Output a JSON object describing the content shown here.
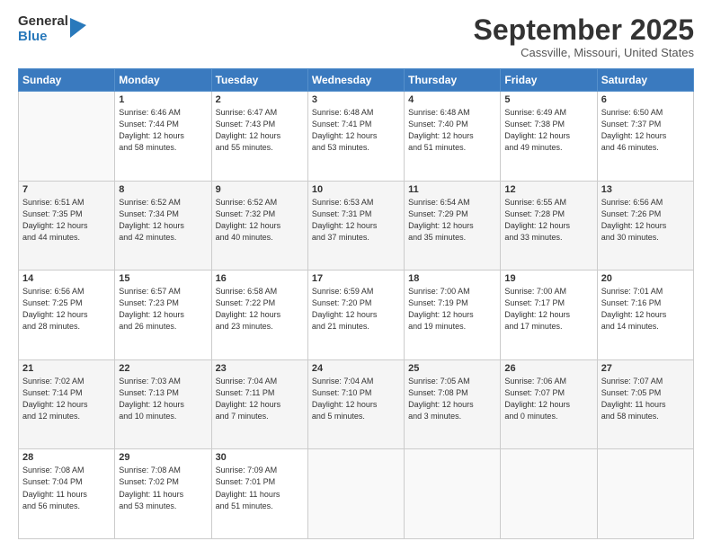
{
  "header": {
    "logo_general": "General",
    "logo_blue": "Blue",
    "month": "September 2025",
    "location": "Cassville, Missouri, United States"
  },
  "days_of_week": [
    "Sunday",
    "Monday",
    "Tuesday",
    "Wednesday",
    "Thursday",
    "Friday",
    "Saturday"
  ],
  "weeks": [
    [
      {
        "num": "",
        "info": ""
      },
      {
        "num": "1",
        "info": "Sunrise: 6:46 AM\nSunset: 7:44 PM\nDaylight: 12 hours\nand 58 minutes."
      },
      {
        "num": "2",
        "info": "Sunrise: 6:47 AM\nSunset: 7:43 PM\nDaylight: 12 hours\nand 55 minutes."
      },
      {
        "num": "3",
        "info": "Sunrise: 6:48 AM\nSunset: 7:41 PM\nDaylight: 12 hours\nand 53 minutes."
      },
      {
        "num": "4",
        "info": "Sunrise: 6:48 AM\nSunset: 7:40 PM\nDaylight: 12 hours\nand 51 minutes."
      },
      {
        "num": "5",
        "info": "Sunrise: 6:49 AM\nSunset: 7:38 PM\nDaylight: 12 hours\nand 49 minutes."
      },
      {
        "num": "6",
        "info": "Sunrise: 6:50 AM\nSunset: 7:37 PM\nDaylight: 12 hours\nand 46 minutes."
      }
    ],
    [
      {
        "num": "7",
        "info": "Sunrise: 6:51 AM\nSunset: 7:35 PM\nDaylight: 12 hours\nand 44 minutes."
      },
      {
        "num": "8",
        "info": "Sunrise: 6:52 AM\nSunset: 7:34 PM\nDaylight: 12 hours\nand 42 minutes."
      },
      {
        "num": "9",
        "info": "Sunrise: 6:52 AM\nSunset: 7:32 PM\nDaylight: 12 hours\nand 40 minutes."
      },
      {
        "num": "10",
        "info": "Sunrise: 6:53 AM\nSunset: 7:31 PM\nDaylight: 12 hours\nand 37 minutes."
      },
      {
        "num": "11",
        "info": "Sunrise: 6:54 AM\nSunset: 7:29 PM\nDaylight: 12 hours\nand 35 minutes."
      },
      {
        "num": "12",
        "info": "Sunrise: 6:55 AM\nSunset: 7:28 PM\nDaylight: 12 hours\nand 33 minutes."
      },
      {
        "num": "13",
        "info": "Sunrise: 6:56 AM\nSunset: 7:26 PM\nDaylight: 12 hours\nand 30 minutes."
      }
    ],
    [
      {
        "num": "14",
        "info": "Sunrise: 6:56 AM\nSunset: 7:25 PM\nDaylight: 12 hours\nand 28 minutes."
      },
      {
        "num": "15",
        "info": "Sunrise: 6:57 AM\nSunset: 7:23 PM\nDaylight: 12 hours\nand 26 minutes."
      },
      {
        "num": "16",
        "info": "Sunrise: 6:58 AM\nSunset: 7:22 PM\nDaylight: 12 hours\nand 23 minutes."
      },
      {
        "num": "17",
        "info": "Sunrise: 6:59 AM\nSunset: 7:20 PM\nDaylight: 12 hours\nand 21 minutes."
      },
      {
        "num": "18",
        "info": "Sunrise: 7:00 AM\nSunset: 7:19 PM\nDaylight: 12 hours\nand 19 minutes."
      },
      {
        "num": "19",
        "info": "Sunrise: 7:00 AM\nSunset: 7:17 PM\nDaylight: 12 hours\nand 17 minutes."
      },
      {
        "num": "20",
        "info": "Sunrise: 7:01 AM\nSunset: 7:16 PM\nDaylight: 12 hours\nand 14 minutes."
      }
    ],
    [
      {
        "num": "21",
        "info": "Sunrise: 7:02 AM\nSunset: 7:14 PM\nDaylight: 12 hours\nand 12 minutes."
      },
      {
        "num": "22",
        "info": "Sunrise: 7:03 AM\nSunset: 7:13 PM\nDaylight: 12 hours\nand 10 minutes."
      },
      {
        "num": "23",
        "info": "Sunrise: 7:04 AM\nSunset: 7:11 PM\nDaylight: 12 hours\nand 7 minutes."
      },
      {
        "num": "24",
        "info": "Sunrise: 7:04 AM\nSunset: 7:10 PM\nDaylight: 12 hours\nand 5 minutes."
      },
      {
        "num": "25",
        "info": "Sunrise: 7:05 AM\nSunset: 7:08 PM\nDaylight: 12 hours\nand 3 minutes."
      },
      {
        "num": "26",
        "info": "Sunrise: 7:06 AM\nSunset: 7:07 PM\nDaylight: 12 hours\nand 0 minutes."
      },
      {
        "num": "27",
        "info": "Sunrise: 7:07 AM\nSunset: 7:05 PM\nDaylight: 11 hours\nand 58 minutes."
      }
    ],
    [
      {
        "num": "28",
        "info": "Sunrise: 7:08 AM\nSunset: 7:04 PM\nDaylight: 11 hours\nand 56 minutes."
      },
      {
        "num": "29",
        "info": "Sunrise: 7:08 AM\nSunset: 7:02 PM\nDaylight: 11 hours\nand 53 minutes."
      },
      {
        "num": "30",
        "info": "Sunrise: 7:09 AM\nSunset: 7:01 PM\nDaylight: 11 hours\nand 51 minutes."
      },
      {
        "num": "",
        "info": ""
      },
      {
        "num": "",
        "info": ""
      },
      {
        "num": "",
        "info": ""
      },
      {
        "num": "",
        "info": ""
      }
    ]
  ]
}
